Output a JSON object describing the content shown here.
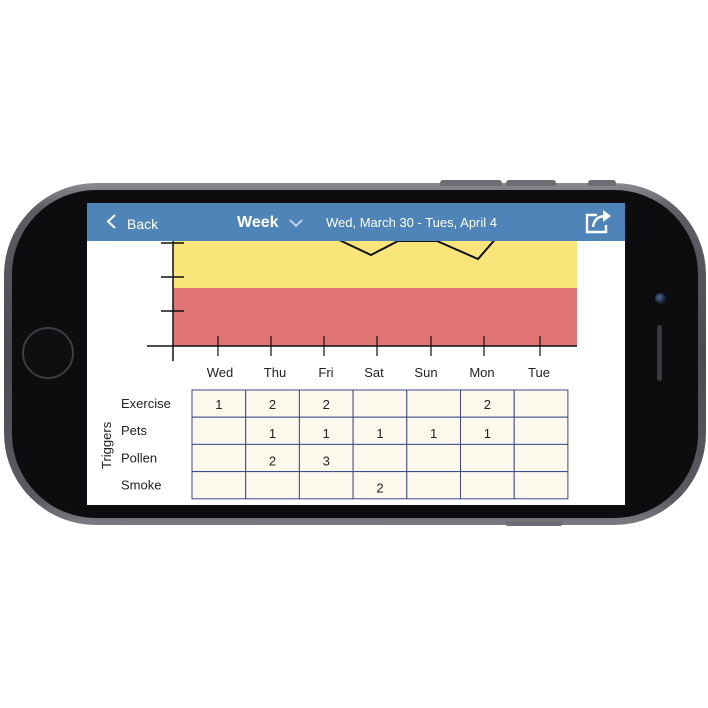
{
  "nav": {
    "back_label": "Back",
    "title": "Week",
    "date_range": "Wed, March 30 - Tues, April 4"
  },
  "icons": [
    "back-chevron-icon",
    "dropdown-chevron-icon",
    "share-icon"
  ],
  "colors": {
    "nav_bar": "#4f84b9",
    "yellow_zone": "#fae57a",
    "red_zone": "#e07574",
    "table_cell": "#fdf8ec",
    "table_border": "#3b4a8c"
  },
  "chart": {
    "days": [
      "Wed",
      "Thu",
      "Fri",
      "Sat",
      "Sun",
      "Mon",
      "Tue"
    ]
  },
  "triggers": {
    "axis_label": "Triggers",
    "rows": [
      {
        "name": "Exercise",
        "values": [
          "1",
          "2",
          "2",
          "",
          "",
          "2",
          ""
        ]
      },
      {
        "name": "Pets",
        "values": [
          "",
          "1",
          "1",
          "1",
          "1",
          "1",
          ""
        ]
      },
      {
        "name": "Pollen",
        "values": [
          "",
          "2",
          "3",
          "",
          "",
          "",
          ""
        ]
      },
      {
        "name": "Smoke",
        "values": [
          "",
          "",
          "",
          "2",
          "",
          "",
          ""
        ]
      }
    ]
  }
}
